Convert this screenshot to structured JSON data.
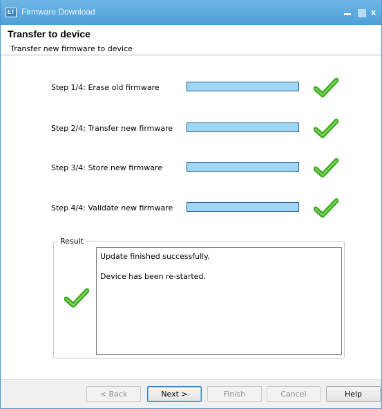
{
  "window": {
    "title": "Firmware Download",
    "icon_text": "ET",
    "close_glyph": "x"
  },
  "header": {
    "title": "Transfer to device",
    "subtitle": "Transfer new firmware to device"
  },
  "steps": [
    {
      "label": "Step 1/4: Erase old firmware",
      "progress": 1.0,
      "status": "check-icon"
    },
    {
      "label": "Step 2/4: Transfer new firmware",
      "progress": 1.0,
      "status": "check-icon"
    },
    {
      "label": "Step 3/4: Store new firmware",
      "progress": 1.0,
      "status": "check-icon"
    },
    {
      "label": "Step 4/4: Validate new firmware",
      "progress": 1.0,
      "status": "check-icon"
    }
  ],
  "result": {
    "legend": "Result",
    "lines": [
      "Update finished successfully.",
      "Device has been re-started."
    ],
    "status": "check-icon"
  },
  "buttons": {
    "back": "< Back",
    "next": "Next >",
    "finish": "Finish",
    "cancel": "Cancel",
    "help": "Help"
  },
  "colors": {
    "titlebar": "#4e9fd9",
    "progress_fill": "#9fd6f3",
    "check_green": "#3aa81e"
  }
}
